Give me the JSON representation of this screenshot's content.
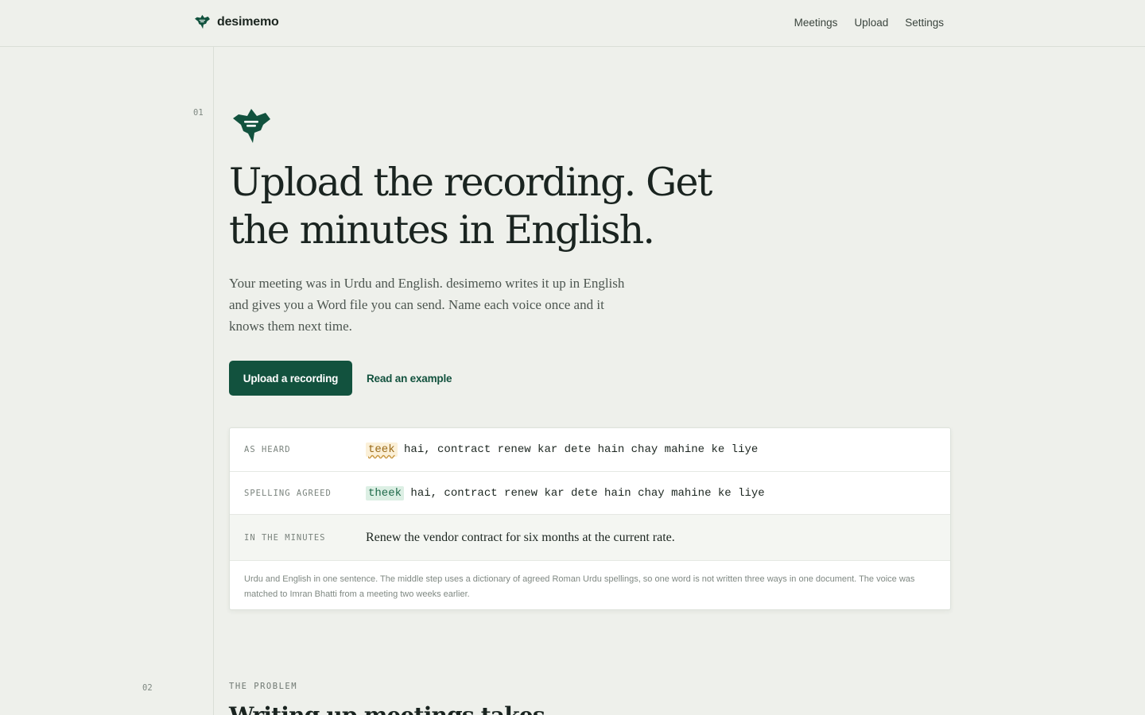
{
  "brand": {
    "name": "desimemo",
    "accent": "#12523e"
  },
  "nav": {
    "items": [
      "Meetings",
      "Upload",
      "Settings"
    ]
  },
  "sections": {
    "first_number": "01",
    "second_number": "02"
  },
  "hero": {
    "title": "Upload the recording. Get the minutes in English.",
    "subtitle": "Your meeting was in Urdu and English. desimemo writes it up in English and gives you a Word file you can send. Name each voice once and it knows them next time.",
    "primary_button": "Upload a recording",
    "secondary_link": "Read an example"
  },
  "example": {
    "as_heard": {
      "label": "AS HEARD",
      "flagged_word": "teek",
      "rest": " hai, contract renew kar dete hain chay mahine ke liye"
    },
    "spelling": {
      "label": "SPELLING AGREED",
      "fixed_word": "theek",
      "rest": " hai, contract renew kar dete hain chay mahine ke liye"
    },
    "minutes": {
      "label": "IN THE MINUTES",
      "text": "Renew the vendor contract for six months at the current rate."
    },
    "note": "Urdu and English in one sentence. The middle step uses a dictionary of agreed Roman Urdu spellings, so one word is not written three ways in one document. The voice was matched to Imran Bhatti from a meeting two weeks earlier."
  },
  "problem": {
    "label": "THE PROBLEM",
    "title": "Writing up meetings takes"
  }
}
